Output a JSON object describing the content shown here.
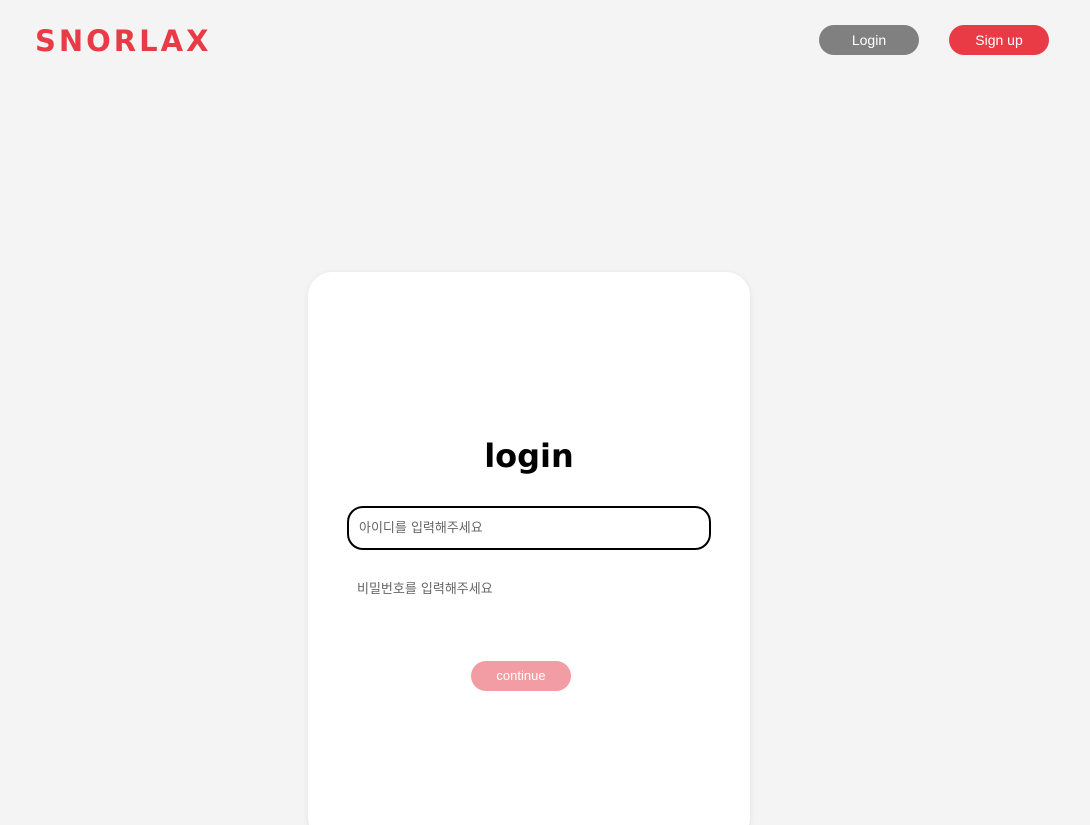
{
  "header": {
    "logo": "SNORLAX",
    "login_label": "Login",
    "signup_label": "Sign up"
  },
  "card": {
    "title": "login",
    "id_placeholder": "아이디를 입력해주세요",
    "password_placeholder": "비밀번호를 입력해주세요",
    "continue_label": "continue"
  },
  "colors": {
    "brand": "#e93b46",
    "login_button": "#808080",
    "continue_button_disabled": "#f29da3",
    "background": "#f4f4f4",
    "card": "#ffffff"
  }
}
